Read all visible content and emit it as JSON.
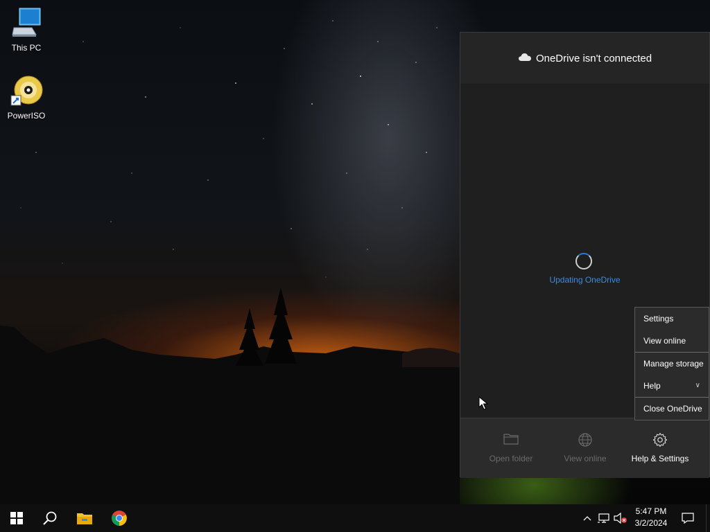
{
  "desktop": {
    "icons": [
      {
        "label": "This PC",
        "icon": "computer-icon"
      },
      {
        "label": "PowerISO",
        "icon": "poweriso-disc-icon"
      }
    ]
  },
  "onedrive": {
    "title": "OneDrive isn't connected",
    "status": "Updating OneDrive",
    "footer": {
      "open_folder": "Open folder",
      "view_online": "View online",
      "help_settings": "Help & Settings"
    },
    "menu": {
      "settings": "Settings",
      "view_online": "View online",
      "manage_storage": "Manage storage",
      "help": "Help",
      "close": "Close OneDrive"
    }
  },
  "taskbar": {
    "time": "5:47 PM",
    "date": "3/2/2024"
  },
  "colors": {
    "accent": "#3b8de0",
    "flyout_bg": "#1f1f1f",
    "taskbar_bg": "#0f0f0f"
  }
}
